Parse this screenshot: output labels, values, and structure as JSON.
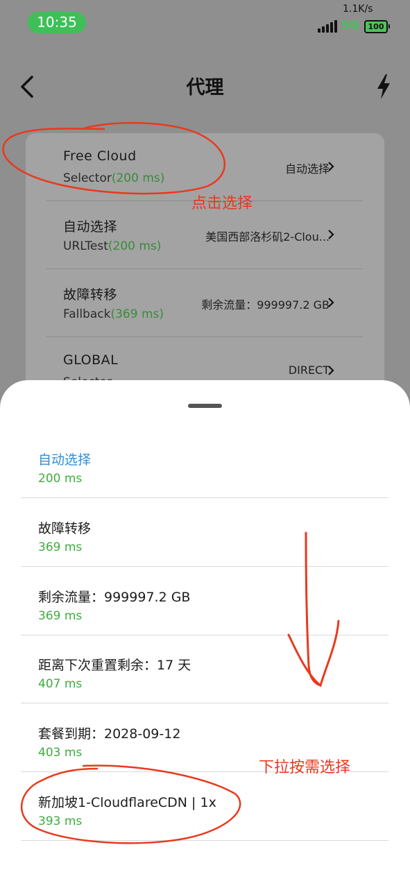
{
  "status_bar": {
    "time": "10:35",
    "net_speed": "1.1K/s",
    "net_type": "5G",
    "battery": "100"
  },
  "nav": {
    "title": "代理",
    "back_icon": "chevron-left-icon",
    "action_icon": "lightning-bolt-icon"
  },
  "groups": [
    {
      "name": "Free Cloud",
      "type": "Selector",
      "latency": "(200 ms)",
      "selected": "自动选择"
    },
    {
      "name": "自动选择",
      "type": "URLTest",
      "latency": "(200 ms)",
      "selected": "美国西部洛杉矶2-Clou..."
    },
    {
      "name": "故障转移",
      "type": "Fallback",
      "latency": "(369 ms)",
      "selected": "剩余流量：999997.2 GB"
    },
    {
      "name": "GLOBAL",
      "type": "Selector",
      "latency": "",
      "selected": "DIRECT"
    }
  ],
  "sheet": {
    "options": [
      {
        "name": "自动选择",
        "latency": "200 ms"
      },
      {
        "name": "故障转移",
        "latency": "369 ms"
      },
      {
        "name": "剩余流量：999997.2 GB",
        "latency": "369 ms"
      },
      {
        "name": "距离下次重置剩余：17 天",
        "latency": "407 ms"
      },
      {
        "name": "套餐到期：2028-09-12",
        "latency": "403 ms"
      },
      {
        "name": "新加坡1-CloudflareCDN | 1x",
        "latency": "393 ms"
      }
    ]
  },
  "annotations": {
    "click_note": "点击选择",
    "pull_note": "下拉按需选择"
  },
  "colors": {
    "latency_green": "#3cae3c",
    "selected_blue": "#2f8fd8",
    "annotation_red": "#e8391e",
    "time_pill": "#3fbf58"
  }
}
